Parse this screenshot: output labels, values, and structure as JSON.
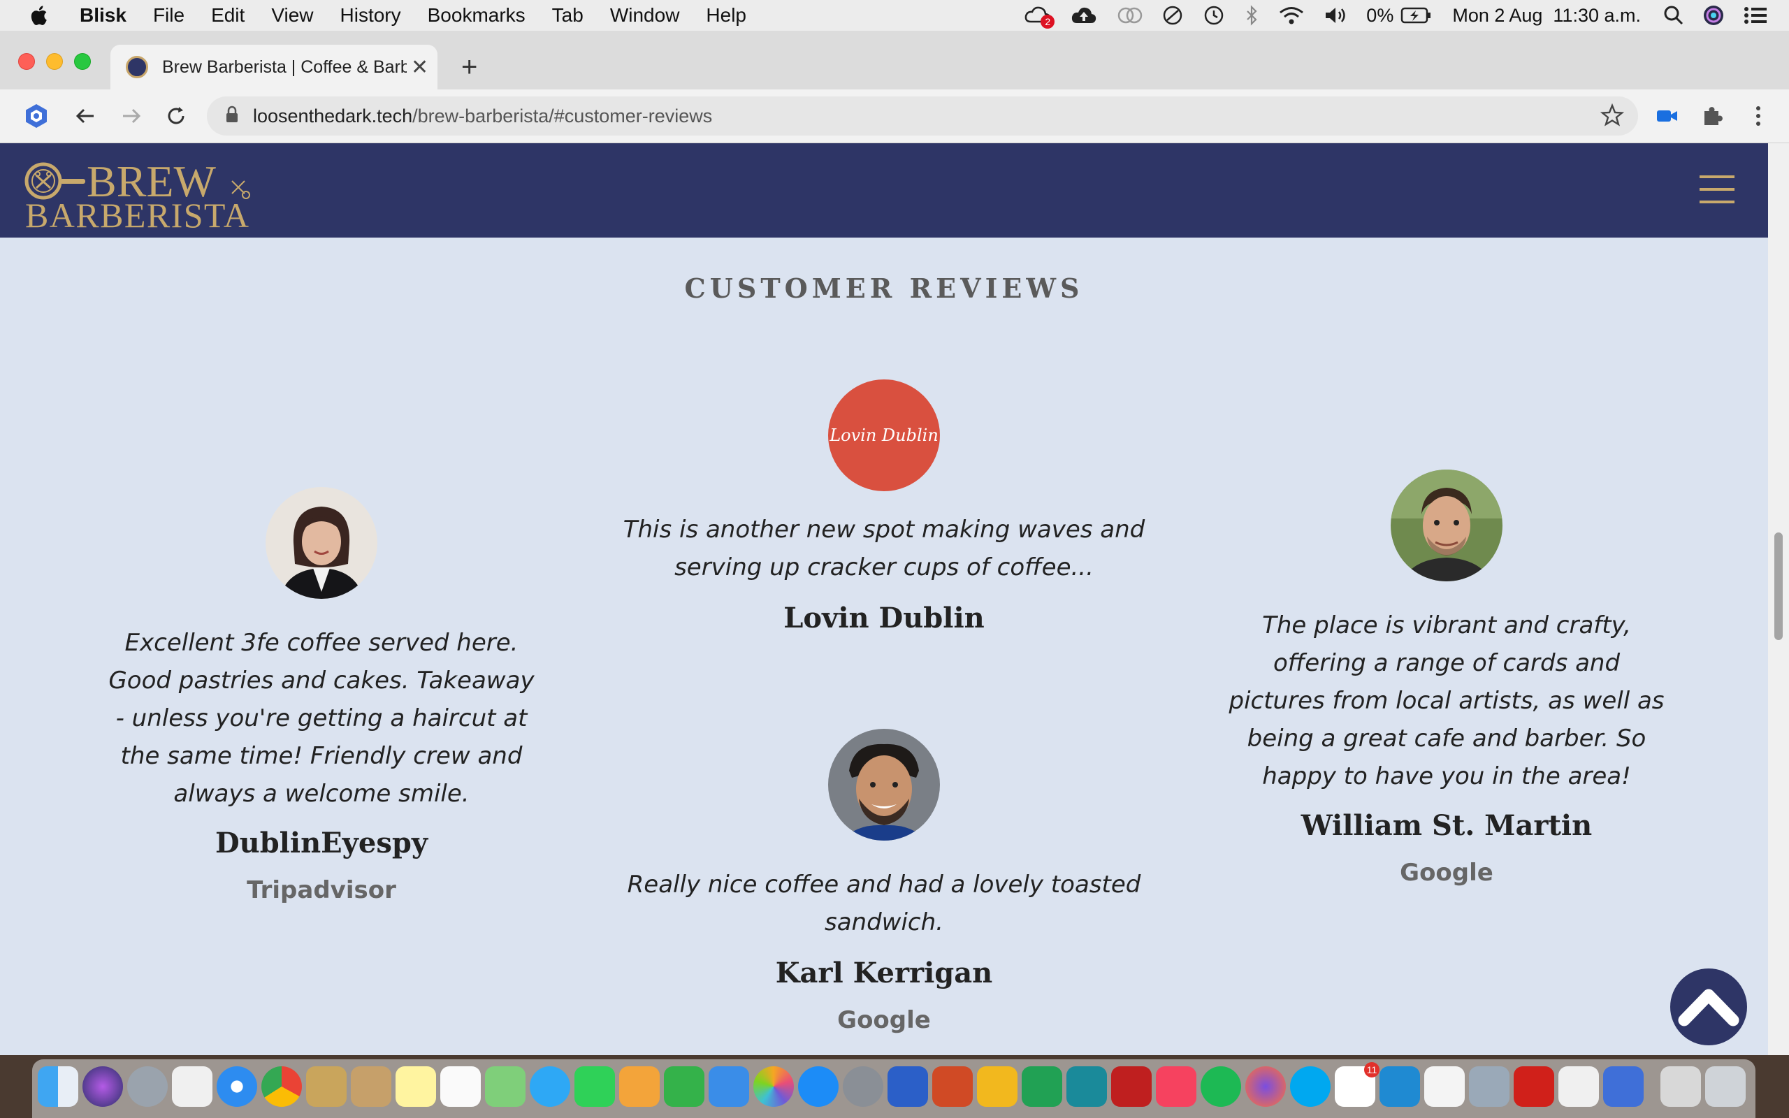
{
  "menubar": {
    "app": "Blisk",
    "items": [
      "File",
      "Edit",
      "View",
      "History",
      "Bookmarks",
      "Tab",
      "Window",
      "Help"
    ],
    "status": {
      "notification_count": "2",
      "battery": "0%",
      "datetime": "Mon 2 Aug  11:30 a.m."
    }
  },
  "browser": {
    "tab_title": "Brew Barberista | Coffee & Barber",
    "url_host": "loosenthedark.tech",
    "url_path": "/brew-barberista/#customer-reviews"
  },
  "site": {
    "logo_line1": "BREW",
    "logo_line2": "BARBERISTA",
    "section_title": "CUSTOMER REVIEWS",
    "colors": {
      "header": "#2e3566",
      "gold": "#c8a96c",
      "page_bg": "#dbe3f0"
    },
    "reviews": [
      {
        "quote": "Excellent 3fe coffee served here. Good pastries and cakes. Takeaway - unless you're getting a haircut at the same time! Friendly crew and always a welcome smile.",
        "quote_lines": [
          "Excellent 3fe coffee served here.",
          "Good pastries and cakes. Takeaway",
          "- unless you're getting a haircut at",
          "the same time! Friendly crew and",
          "always a welcome smile."
        ],
        "name": "DublinEyespy",
        "source": "Tripadvisor"
      },
      {
        "avatar_text": "Lovin Dublin",
        "quote_lines": [
          "This is another new spot making waves and",
          "serving up cracker cups of coffee..."
        ],
        "name": "Lovin Dublin",
        "source": ""
      },
      {
        "quote_lines": [
          "Really nice coffee and had a lovely toasted",
          "sandwich."
        ],
        "name": "Karl Kerrigan",
        "source": "Google"
      },
      {
        "quote_lines": [
          "The place is vibrant and crafty,",
          "offering a range of cards and",
          "pictures from local artists, as well as",
          "being a great cafe and barber. So",
          "happy to have you in the area!"
        ],
        "name": "William St. Martin",
        "source": "Google"
      }
    ]
  },
  "dock": {
    "slack_badge": "11"
  }
}
